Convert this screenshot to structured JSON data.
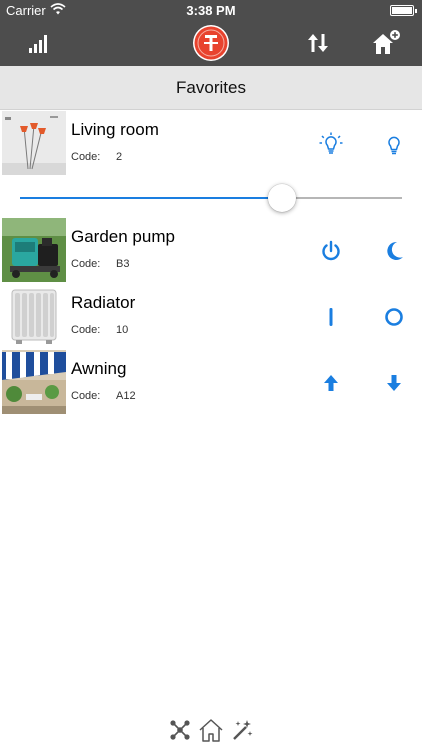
{
  "status_bar": {
    "carrier": "Carrier",
    "time": "3:38 PM"
  },
  "toolbar": {
    "signal_icon": "signal-bars-icon",
    "logo_icon": "app-logo-icon",
    "sort_icon": "sort-arrows-icon",
    "add_home_icon": "add-home-icon"
  },
  "section": {
    "title": "Favorites"
  },
  "accent_color": "#1a7ee0",
  "devices": [
    {
      "name": "Living room",
      "code_label": "Code:",
      "code": "2",
      "actions": [
        "lightbulb-on-icon",
        "lightbulb-off-icon"
      ]
    },
    {
      "name": "Garden pump",
      "code_label": "Code:",
      "code": "B3",
      "actions": [
        "power-icon",
        "moon-icon"
      ]
    },
    {
      "name": "Radiator",
      "code_label": "Code:",
      "code": "10",
      "actions": [
        "on-bar-icon",
        "off-circle-icon"
      ]
    },
    {
      "name": "Awning",
      "code_label": "Code:",
      "code": "A12",
      "actions": [
        "arrow-up-icon",
        "arrow-down-icon"
      ]
    }
  ],
  "dimmer": {
    "level": 0.7
  },
  "bottom_bar": [
    "network-icon",
    "home-outline-icon",
    "magic-wand-icon"
  ]
}
